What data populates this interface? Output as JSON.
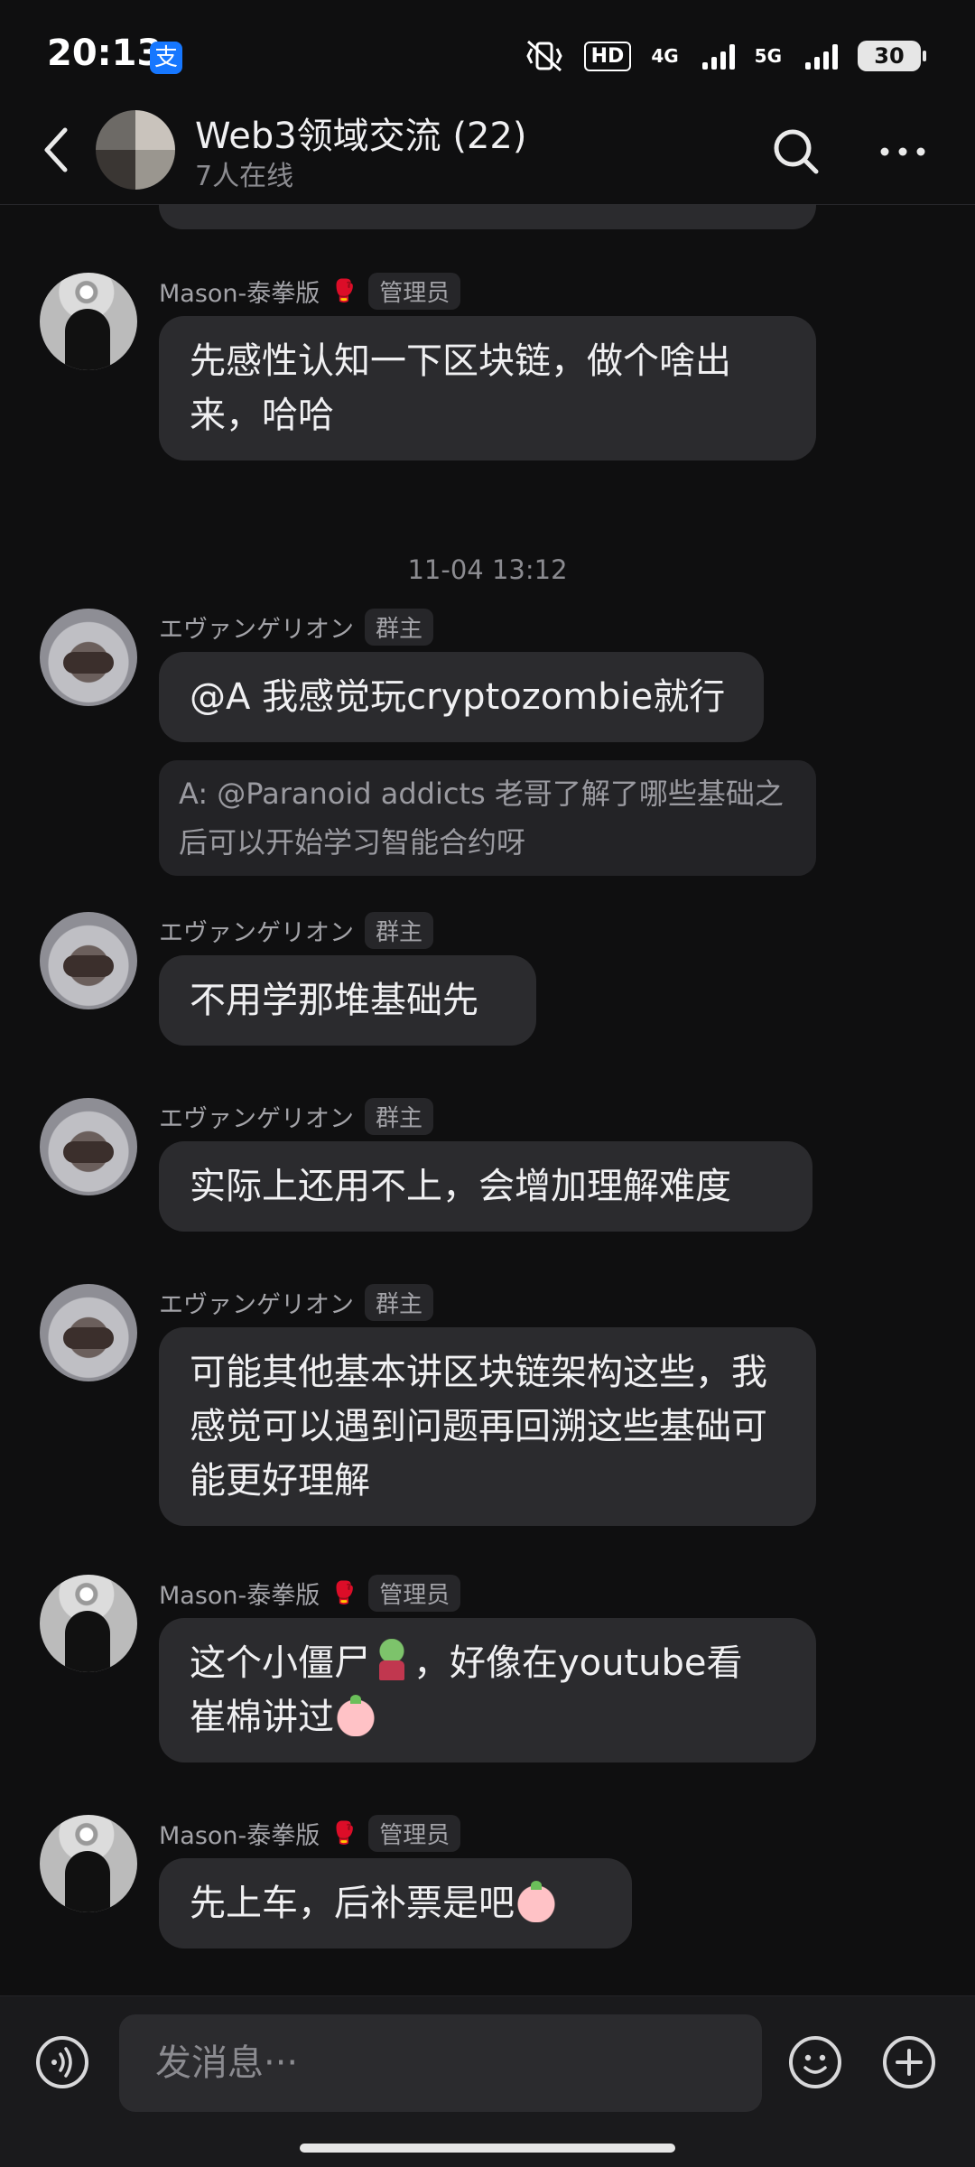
{
  "status_bar": {
    "time": "20:13",
    "app_icon": "alipay-icon",
    "hd_label": "HD",
    "net1": "4G",
    "net2": "5G",
    "battery": "30"
  },
  "header": {
    "title": "Web3领域交流 (22)",
    "subtitle": "7人在线"
  },
  "chat": {
    "messages": [
      {
        "name": "Mason-泰拳版",
        "role": "管理员",
        "text": "先感性认知一下区块链，做个啥出来，哈哈"
      },
      {
        "timestamp": "11-04 13:12"
      },
      {
        "name": "エヴァンゲリオン",
        "role": "群主",
        "text": "@A  我感觉玩cryptozombie就行",
        "quote": "A: @Paranoid addicts 老哥了解了哪些基础之后可以开始学习智能合约呀"
      },
      {
        "name": "エヴァンゲリオン",
        "role": "群主",
        "text": "不用学那堆基础先"
      },
      {
        "name": "エヴァンゲリオン",
        "role": "群主",
        "text": "实际上还用不上，会增加理解难度"
      },
      {
        "name": "エヴァンゲリオン",
        "role": "群主",
        "text": "可能其他基本讲区块链架构这些，我感觉可以遇到问题再回溯这些基础可能更好理解"
      },
      {
        "name": "Mason-泰拳版",
        "role": "管理员",
        "text_a": "这个小僵尸",
        "text_b": "，好像在youtube看 崔棉讲过"
      },
      {
        "name": "Mason-泰拳版",
        "role": "管理员",
        "text": "先上车，后补票是吧"
      }
    ]
  },
  "input_bar": {
    "placeholder": "发消息···"
  },
  "colors": {
    "background": "#0f0f10",
    "bubble": "#2b2b2e",
    "muted_text": "#8b8b90"
  }
}
